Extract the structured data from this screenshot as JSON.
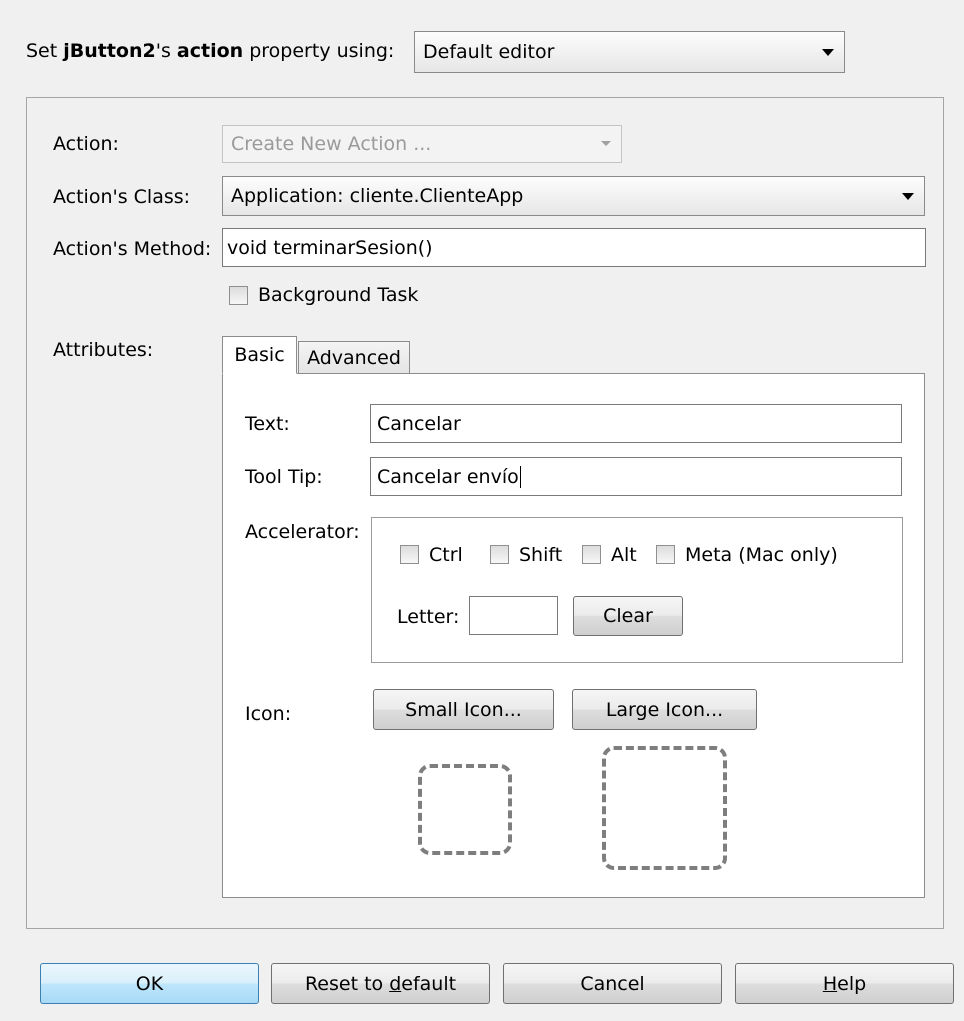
{
  "header": {
    "prefix": "Set ",
    "component": "jButton2",
    "possessive": "'s ",
    "property": "action",
    "suffix": " property using:",
    "editor_selected": "Default editor"
  },
  "form": {
    "action_label": "Action:",
    "action_value": "Create New Action ...",
    "action_class_label": "Action's Class:",
    "action_class_value": "Application: cliente.ClienteApp",
    "action_method_label": "Action's Method:",
    "action_method_value": "void terminarSesion()",
    "background_task_label": "Background Task",
    "background_task_checked": false,
    "attributes_label": "Attributes:"
  },
  "tabs": [
    {
      "label": "Basic",
      "active": true
    },
    {
      "label": "Advanced",
      "active": false
    }
  ],
  "basic": {
    "text_label": "Text:",
    "text_value": "Cancelar",
    "tooltip_label": "Tool Tip:",
    "tooltip_value": "Cancelar envío",
    "accelerator_label": "Accelerator:",
    "modifiers": {
      "ctrl": "Ctrl",
      "shift": "Shift",
      "alt": "Alt",
      "meta": "Meta (Mac only)"
    },
    "letter_label": "Letter:",
    "letter_value": "",
    "clear_button": "Clear",
    "icon_label": "Icon:",
    "small_icon_button": "Small Icon...",
    "large_icon_button": "Large Icon..."
  },
  "footer": {
    "ok": "OK",
    "reset_pre": "Reset to ",
    "reset_underlined": "d",
    "reset_post": "efault",
    "cancel": "Cancel",
    "help_underlined": "H",
    "help_post": "elp"
  }
}
